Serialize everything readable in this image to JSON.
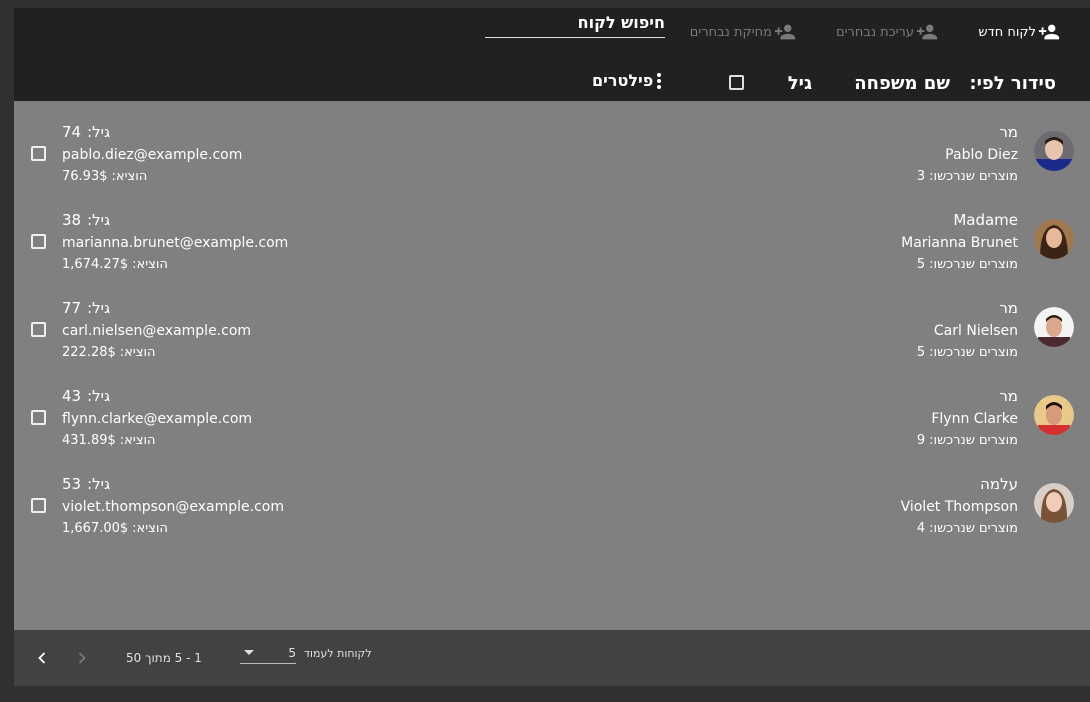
{
  "toolbar": {
    "new_customer": "לקוח חדש",
    "edit_selected": "עריכת נבחרים",
    "delete_selected": "מחיקת נבחרים",
    "search_placeholder": "חיפוש לקוח",
    "sort_by": "סידור לפי:",
    "sort_last_name": "שם משפחה",
    "sort_age": "גיל",
    "filters": "פילטרים",
    "icon": "person-add-icon"
  },
  "labels": {
    "age": "גיל:",
    "spent": "הוציא:",
    "purchases": "מוצרים שנרכשו:"
  },
  "customers": [
    {
      "title": "מר",
      "name": "Pablo Diez",
      "purchases": "3",
      "age": "74",
      "email": "pablo.diez@example.com",
      "spent": "76.93$"
    },
    {
      "title": "Madame",
      "name": "Marianna Brunet",
      "purchases": "5",
      "age": "38",
      "email": "marianna.brunet@example.com",
      "spent": "1,674.27$"
    },
    {
      "title": "מר",
      "name": "Carl Nielsen",
      "purchases": "5",
      "age": "77",
      "email": "carl.nielsen@example.com",
      "spent": "222.28$"
    },
    {
      "title": "מר",
      "name": "Flynn Clarke",
      "purchases": "9",
      "age": "43",
      "email": "flynn.clarke@example.com",
      "spent": "431.89$"
    },
    {
      "title": "עלמה",
      "name": "Violet Thompson",
      "purchases": "4",
      "age": "53",
      "email": "violet.thompson@example.com",
      "spent": "1,667.00$"
    }
  ],
  "pagination": {
    "per_page_label": "לקוחות לעמוד",
    "per_page_value": "5",
    "range": "1 - 5 מתוך 50"
  },
  "colors": {
    "toolbar_bg": "#212121",
    "list_bg": "#808080",
    "pager_bg": "#424242",
    "disabled_text": "#7a7a7a"
  }
}
